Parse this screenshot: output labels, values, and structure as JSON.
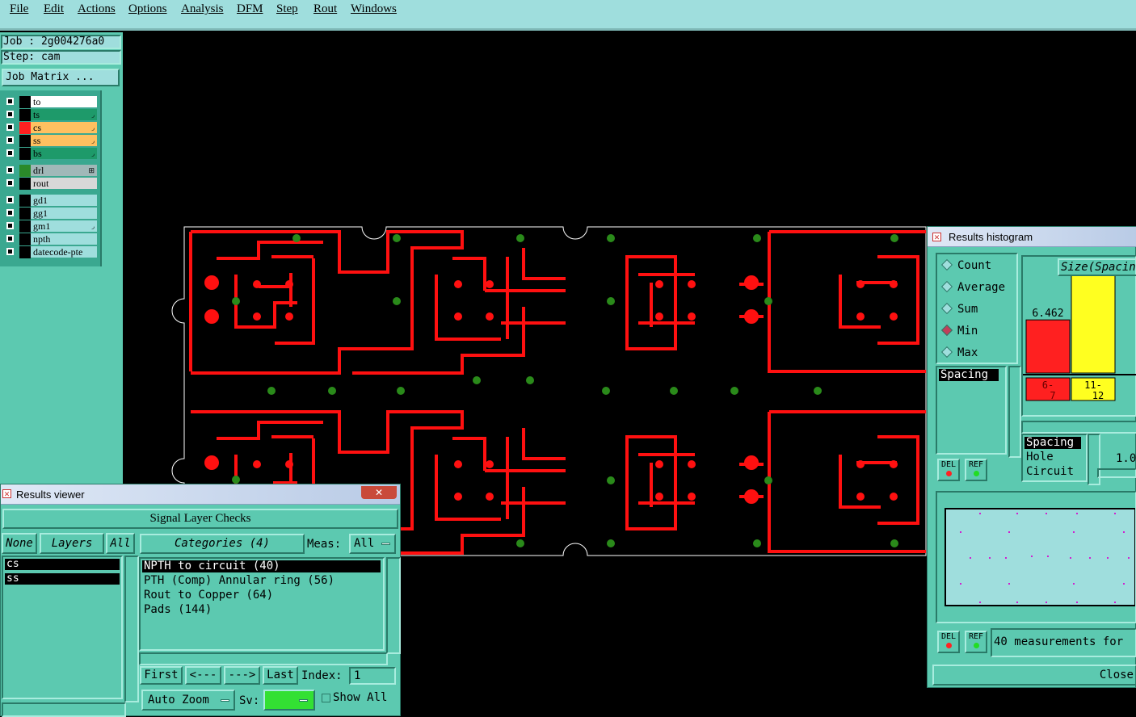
{
  "menu": [
    "File",
    "Edit",
    "Actions",
    "Options",
    "Analysis",
    "DFM",
    "Step",
    "Rout",
    "Windows"
  ],
  "job": {
    "job_line": "Job : 2g004276a0",
    "step_line": "Step: cam",
    "matrix_button": "Job Matrix ..."
  },
  "layers": [
    {
      "name": "to",
      "color": "#ffffff",
      "swatch": "#000000",
      "arrow": ""
    },
    {
      "name": "ts",
      "color": "#1e9a6a",
      "swatch": "#000000",
      "arrow": "◞"
    },
    {
      "name": "cs",
      "color": "#ffc060",
      "swatch": "#ff2020",
      "arrow": "◞"
    },
    {
      "name": "ss",
      "color": "#ffc060",
      "swatch": "#000000",
      "arrow": "◞"
    },
    {
      "name": "bs",
      "color": "#1e9a6a",
      "swatch": "#000000",
      "arrow": "◞"
    },
    {
      "name": "drl",
      "color": "#a0b8b8",
      "swatch": "#2a8a2a",
      "arrow": "⊞"
    },
    {
      "name": "rout",
      "color": "#d8d8d8",
      "swatch": "#000000",
      "arrow": ""
    },
    {
      "name": "gd1",
      "color": "#9fdedd",
      "swatch": "#000000",
      "arrow": ""
    },
    {
      "name": "gg1",
      "color": "#9fdedd",
      "swatch": "#000000",
      "arrow": ""
    },
    {
      "name": "gm1",
      "color": "#9fdedd",
      "swatch": "#000000",
      "arrow": "◞"
    },
    {
      "name": "npth",
      "color": "#9fdedd",
      "swatch": "#000000",
      "arrow": ""
    },
    {
      "name": "datecode-pte",
      "color": "#9fdedd",
      "swatch": "#000000",
      "arrow": ""
    }
  ],
  "results_viewer": {
    "title": "Results viewer",
    "close": "✕",
    "header": "Signal Layer Checks",
    "none": "None",
    "layers": "Layers",
    "all": "All",
    "layer_list": [
      "cs",
      "ss"
    ],
    "categories_label": "Categories (4)",
    "meas_label": "Meas:",
    "meas_value": "All",
    "categories": [
      "NPTH to circuit (40)",
      "PTH (Comp) Annular ring (56)",
      "Rout to Copper (64)",
      "Pads (144)"
    ],
    "first": "First",
    "prev": "<---",
    "next": "--->",
    "last": "Last",
    "index_label": "Index:",
    "index_value": "1",
    "auto_zoom": "Auto Zoom",
    "sv_label": "Sv:",
    "show_all": "Show All"
  },
  "histogram": {
    "title": "Results histogram",
    "options": [
      "Count",
      "Average",
      "Sum",
      "Min",
      "Max"
    ],
    "selected_option": "Min",
    "list_item": "Spacing",
    "del": "DEL",
    "ref": "REF",
    "chart_title": "Size(Spacing",
    "sub_list": [
      "Spacing",
      "Hole",
      "Circuit"
    ],
    "partial_value": "1.0",
    "status": "40 measurements for",
    "close": "Close"
  },
  "chart_data": {
    "type": "bar",
    "title": "Size(Spacing",
    "categories": [
      "6-7",
      "11-12"
    ],
    "values": [
      6.462,
      11.975
    ],
    "colors": [
      "#ff2020",
      "#ffff20"
    ]
  }
}
